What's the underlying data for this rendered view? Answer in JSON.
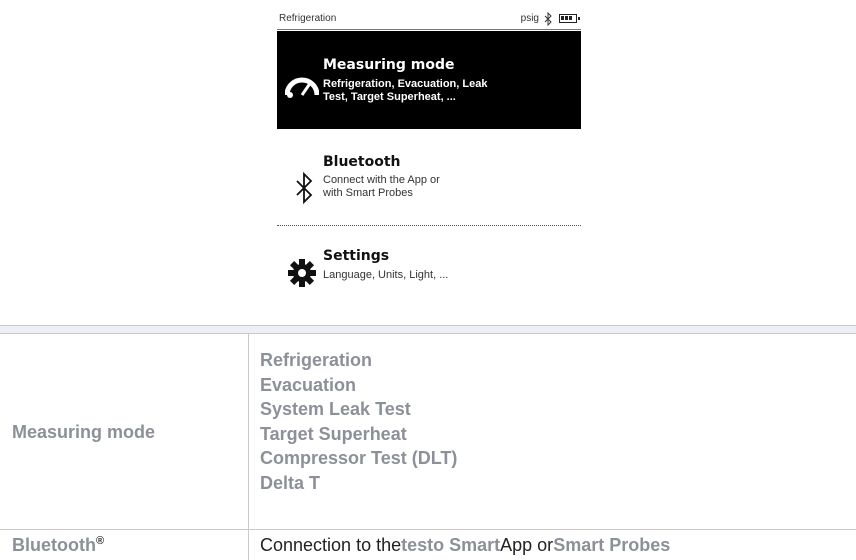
{
  "device": {
    "status_title": "Refrigeration",
    "unit": "psig",
    "menu": [
      {
        "title": "Measuring mode",
        "subtitle": "Refrigeration, Evacuation, Leak\nTest, Target Superheat, ...",
        "icon": "gauge-icon",
        "selected": true
      },
      {
        "title": "Bluetooth",
        "subtitle": "Connect with the App or\nwith Smart Probes",
        "icon": "bluetooth-icon",
        "selected": false
      },
      {
        "title": "Settings",
        "subtitle": "Language, Units, Light, ...",
        "icon": "gear-icon",
        "selected": false
      }
    ]
  },
  "table": {
    "measuring_mode_label": "Measuring mode",
    "modes": [
      "Refrigeration",
      "Evacuation",
      "System Leak Test",
      "Target Superheat",
      "Compressor Test (DLT)",
      "Delta T"
    ],
    "bluetooth_label": "Bluetooth",
    "bluetooth_reg": "®",
    "bluetooth_desc": {
      "p1": "Connection to the ",
      "app": "testo Smart",
      "p2": " App or ",
      "probes": "Smart Probes"
    }
  },
  "colors": {
    "label_gray": "#8c9098",
    "grid": "#c9c9c9",
    "gap_row": "#eceff4"
  }
}
